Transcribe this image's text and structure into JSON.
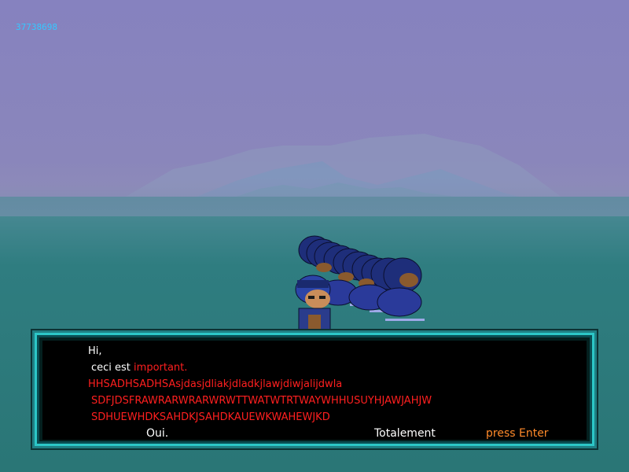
{
  "hud": {
    "counter": "37738698"
  },
  "dialog": {
    "greeting": "Hi,",
    "line2_plain": "ceci est ",
    "line2_highlight": "important.",
    "line3": "HHSADHSADHSAsjdasjdliakjdladkjlawjdiwjalijdwla",
    "line4": "SDFJDSFRAWRARWRARWRWTTWATWTRTWAYWHHUSUYHJAWJAHJW",
    "line5": "SDHUEWHDKSAHDKJSAHDKAUEWKWAHEWJKD",
    "choices": [
      "Oui.",
      "Totalement"
    ],
    "prompt": "press Enter"
  },
  "colors": {
    "sky": "#8a84bf",
    "sea": "#2f7c7b",
    "dialog_border": "#2cc7c7",
    "emphasis": "#ff1f1f",
    "prompt": "#ff8a2a",
    "counter": "#35c8ff"
  }
}
